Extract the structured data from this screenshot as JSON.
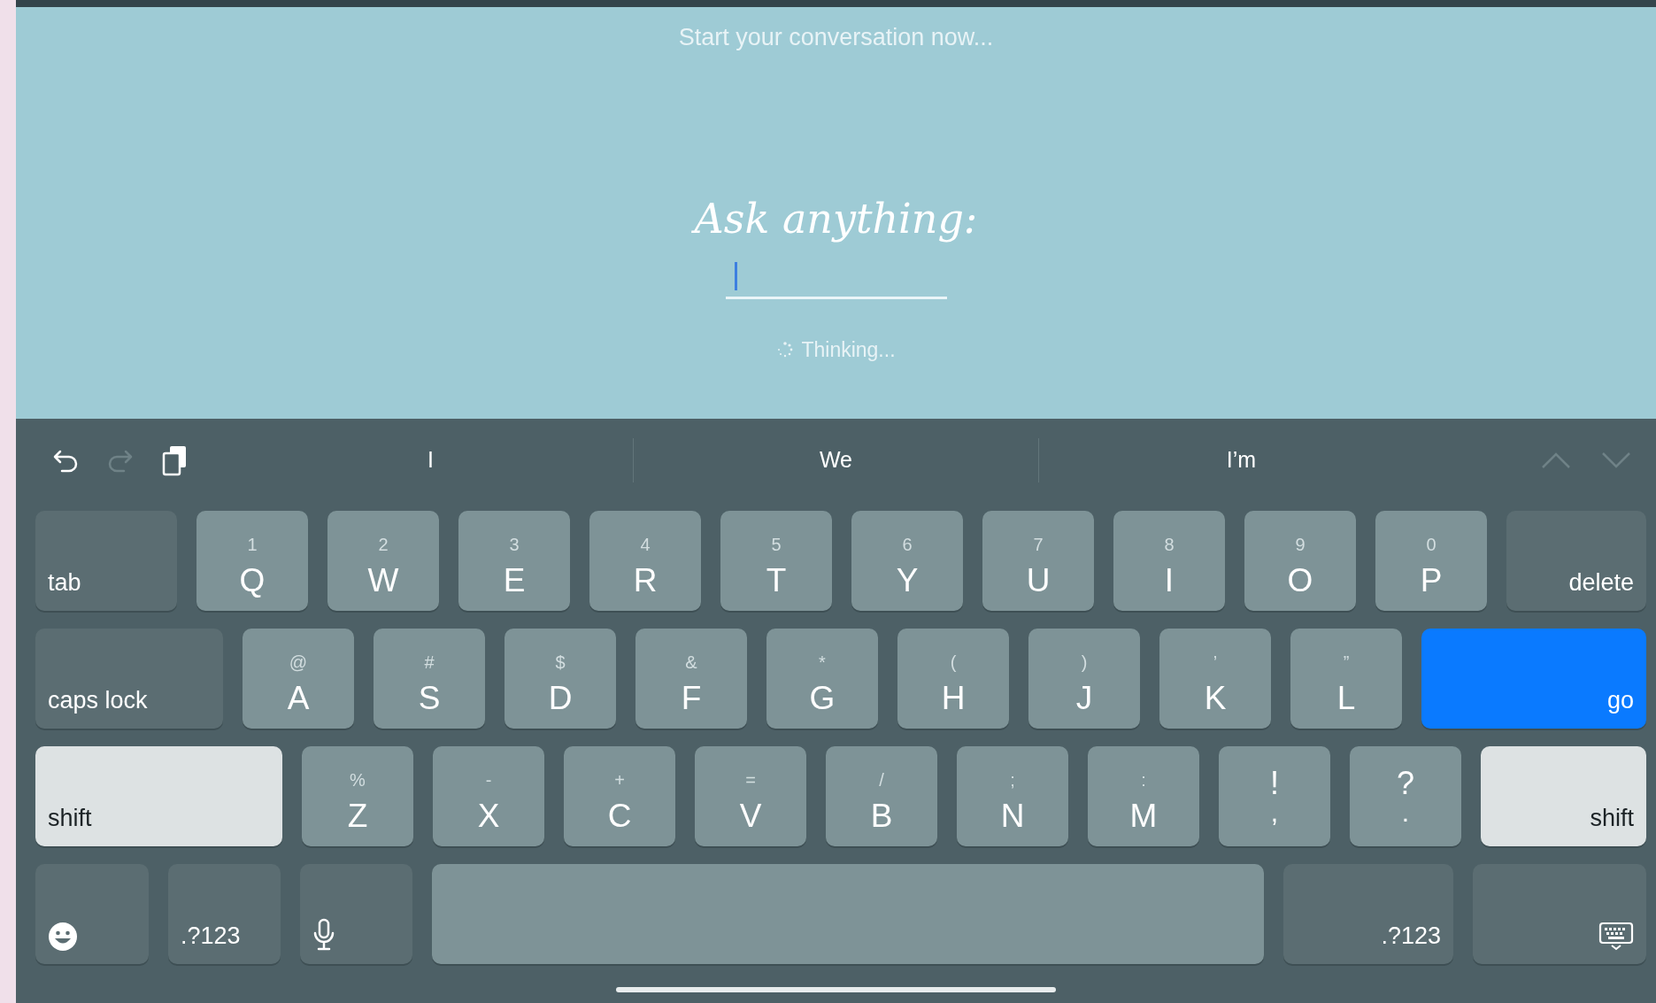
{
  "header": {
    "text": "Start your conversation now..."
  },
  "prompt": {
    "title": "Ask anything:",
    "focused": true
  },
  "status": {
    "text": "Thinking..."
  },
  "toolbar": {
    "undo_enabled": true,
    "redo_enabled": false
  },
  "suggestions": [
    "I",
    "We",
    "I’m"
  ],
  "rows": [
    [
      {
        "kind": "tab",
        "label": "tab"
      },
      {
        "kind": "letter",
        "label": "Q",
        "secondary": "1"
      },
      {
        "kind": "letter",
        "label": "W",
        "secondary": "2"
      },
      {
        "kind": "letter",
        "label": "E",
        "secondary": "3"
      },
      {
        "kind": "letter",
        "label": "R",
        "secondary": "4"
      },
      {
        "kind": "letter",
        "label": "T",
        "secondary": "5"
      },
      {
        "kind": "letter",
        "label": "Y",
        "secondary": "6"
      },
      {
        "kind": "letter",
        "label": "U",
        "secondary": "7"
      },
      {
        "kind": "letter",
        "label": "I",
        "secondary": "8"
      },
      {
        "kind": "letter",
        "label": "O",
        "secondary": "9"
      },
      {
        "kind": "letter",
        "label": "P",
        "secondary": "0"
      },
      {
        "kind": "delete",
        "label": "delete"
      }
    ],
    [
      {
        "kind": "caps",
        "label": "caps lock"
      },
      {
        "kind": "letter",
        "label": "A",
        "secondary": "@"
      },
      {
        "kind": "letter",
        "label": "S",
        "secondary": "#"
      },
      {
        "kind": "letter",
        "label": "D",
        "secondary": "$"
      },
      {
        "kind": "letter",
        "label": "F",
        "secondary": "&"
      },
      {
        "kind": "letter",
        "label": "G",
        "secondary": "*"
      },
      {
        "kind": "letter",
        "label": "H",
        "secondary": "("
      },
      {
        "kind": "letter",
        "label": "J",
        "secondary": ")"
      },
      {
        "kind": "letter",
        "label": "K",
        "secondary": "’"
      },
      {
        "kind": "letter",
        "label": "L",
        "secondary": "”"
      },
      {
        "kind": "go",
        "label": "go"
      }
    ],
    [
      {
        "kind": "shift",
        "label": "shift"
      },
      {
        "kind": "letter",
        "label": "Z",
        "secondary": "%"
      },
      {
        "kind": "letter",
        "label": "X",
        "secondary": "-"
      },
      {
        "kind": "letter",
        "label": "C",
        "secondary": "+"
      },
      {
        "kind": "letter",
        "label": "V",
        "secondary": "="
      },
      {
        "kind": "letter",
        "label": "B",
        "secondary": "/"
      },
      {
        "kind": "letter",
        "label": "N",
        "secondary": ";"
      },
      {
        "kind": "letter",
        "label": "M",
        "secondary": ":"
      },
      {
        "kind": "punct",
        "label": ",",
        "secondary": "!"
      },
      {
        "kind": "punct",
        "label": ".",
        "secondary": "?"
      },
      {
        "kind": "rshift",
        "label": "shift"
      }
    ],
    [
      {
        "kind": "emoji"
      },
      {
        "kind": "mode",
        "label": ".?123"
      },
      {
        "kind": "mic"
      },
      {
        "kind": "space"
      },
      {
        "kind": "rmode",
        "label": ".?123"
      },
      {
        "kind": "hide"
      }
    ]
  ]
}
